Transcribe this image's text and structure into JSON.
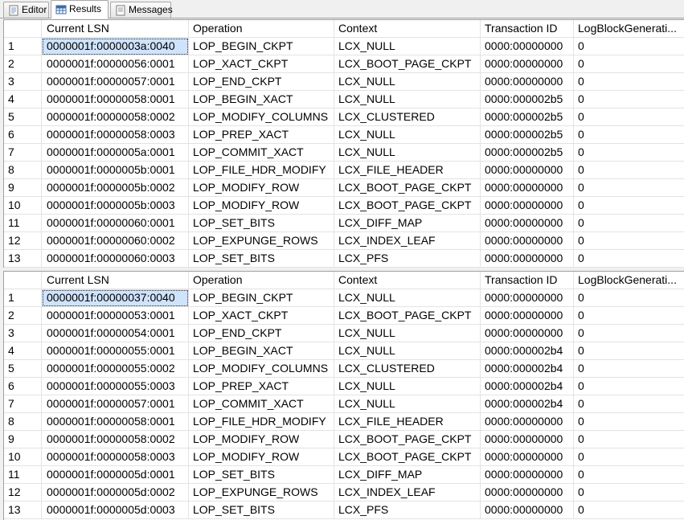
{
  "tabs": [
    {
      "label": "Editor",
      "icon": "editor-icon"
    },
    {
      "label": "Results",
      "icon": "results-grid-icon"
    },
    {
      "label": "Messages",
      "icon": "messages-icon"
    }
  ],
  "columns": [
    "Current LSN",
    "Operation",
    "Context",
    "Transaction ID",
    "LogBlockGenerati..."
  ],
  "grids": [
    {
      "rows": [
        [
          "1",
          "0000001f:0000003a:0040",
          "LOP_BEGIN_CKPT",
          "LCX_NULL",
          "0000:00000000",
          "0"
        ],
        [
          "2",
          "0000001f:00000056:0001",
          "LOP_XACT_CKPT",
          "LCX_BOOT_PAGE_CKPT",
          "0000:00000000",
          "0"
        ],
        [
          "3",
          "0000001f:00000057:0001",
          "LOP_END_CKPT",
          "LCX_NULL",
          "0000:00000000",
          "0"
        ],
        [
          "4",
          "0000001f:00000058:0001",
          "LOP_BEGIN_XACT",
          "LCX_NULL",
          "0000:000002b5",
          "0"
        ],
        [
          "5",
          "0000001f:00000058:0002",
          "LOP_MODIFY_COLUMNS",
          "LCX_CLUSTERED",
          "0000:000002b5",
          "0"
        ],
        [
          "6",
          "0000001f:00000058:0003",
          "LOP_PREP_XACT",
          "LCX_NULL",
          "0000:000002b5",
          "0"
        ],
        [
          "7",
          "0000001f:0000005a:0001",
          "LOP_COMMIT_XACT",
          "LCX_NULL",
          "0000:000002b5",
          "0"
        ],
        [
          "8",
          "0000001f:0000005b:0001",
          "LOP_FILE_HDR_MODIFY",
          "LCX_FILE_HEADER",
          "0000:00000000",
          "0"
        ],
        [
          "9",
          "0000001f:0000005b:0002",
          "LOP_MODIFY_ROW",
          "LCX_BOOT_PAGE_CKPT",
          "0000:00000000",
          "0"
        ],
        [
          "10",
          "0000001f:0000005b:0003",
          "LOP_MODIFY_ROW",
          "LCX_BOOT_PAGE_CKPT",
          "0000:00000000",
          "0"
        ],
        [
          "11",
          "0000001f:00000060:0001",
          "LOP_SET_BITS",
          "LCX_DIFF_MAP",
          "0000:00000000",
          "0"
        ],
        [
          "12",
          "0000001f:00000060:0002",
          "LOP_EXPUNGE_ROWS",
          "LCX_INDEX_LEAF",
          "0000:00000000",
          "0"
        ],
        [
          "13",
          "0000001f:00000060:0003",
          "LOP_SET_BITS",
          "LCX_PFS",
          "0000:00000000",
          "0"
        ]
      ]
    },
    {
      "rows": [
        [
          "1",
          "0000001f:00000037:0040",
          "LOP_BEGIN_CKPT",
          "LCX_NULL",
          "0000:00000000",
          "0"
        ],
        [
          "2",
          "0000001f:00000053:0001",
          "LOP_XACT_CKPT",
          "LCX_BOOT_PAGE_CKPT",
          "0000:00000000",
          "0"
        ],
        [
          "3",
          "0000001f:00000054:0001",
          "LOP_END_CKPT",
          "LCX_NULL",
          "0000:00000000",
          "0"
        ],
        [
          "4",
          "0000001f:00000055:0001",
          "LOP_BEGIN_XACT",
          "LCX_NULL",
          "0000:000002b4",
          "0"
        ],
        [
          "5",
          "0000001f:00000055:0002",
          "LOP_MODIFY_COLUMNS",
          "LCX_CLUSTERED",
          "0000:000002b4",
          "0"
        ],
        [
          "6",
          "0000001f:00000055:0003",
          "LOP_PREP_XACT",
          "LCX_NULL",
          "0000:000002b4",
          "0"
        ],
        [
          "7",
          "0000001f:00000057:0001",
          "LOP_COMMIT_XACT",
          "LCX_NULL",
          "0000:000002b4",
          "0"
        ],
        [
          "8",
          "0000001f:00000058:0001",
          "LOP_FILE_HDR_MODIFY",
          "LCX_FILE_HEADER",
          "0000:00000000",
          "0"
        ],
        [
          "9",
          "0000001f:00000058:0002",
          "LOP_MODIFY_ROW",
          "LCX_BOOT_PAGE_CKPT",
          "0000:00000000",
          "0"
        ],
        [
          "10",
          "0000001f:00000058:0003",
          "LOP_MODIFY_ROW",
          "LCX_BOOT_PAGE_CKPT",
          "0000:00000000",
          "0"
        ],
        [
          "11",
          "0000001f:0000005d:0001",
          "LOP_SET_BITS",
          "LCX_DIFF_MAP",
          "0000:00000000",
          "0"
        ],
        [
          "12",
          "0000001f:0000005d:0002",
          "LOP_EXPUNGE_ROWS",
          "LCX_INDEX_LEAF",
          "0000:00000000",
          "0"
        ],
        [
          "13",
          "0000001f:0000005d:0003",
          "LOP_SET_BITS",
          "LCX_PFS",
          "0000:00000000",
          "0"
        ]
      ]
    }
  ],
  "colors": {
    "selection": "#cfe3fb",
    "grid_line": "#e3e3e3"
  }
}
